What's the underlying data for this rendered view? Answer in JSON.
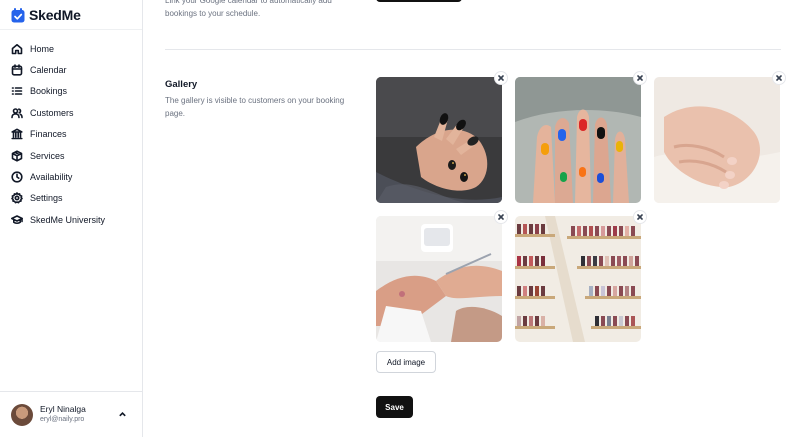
{
  "app": {
    "name": "SkedMe",
    "brand_color": "#2563eb"
  },
  "sidebar": {
    "items": [
      {
        "label": "Home",
        "icon": "home-icon"
      },
      {
        "label": "Calendar",
        "icon": "calendar-icon"
      },
      {
        "label": "Bookings",
        "icon": "list-icon"
      },
      {
        "label": "Customers",
        "icon": "users-icon"
      },
      {
        "label": "Finances",
        "icon": "bank-icon"
      },
      {
        "label": "Services",
        "icon": "box-icon"
      },
      {
        "label": "Availability",
        "icon": "clock-icon"
      },
      {
        "label": "Settings",
        "icon": "gear-icon"
      },
      {
        "label": "SkedMe University",
        "icon": "graduation-cap-icon"
      }
    ],
    "user": {
      "name": "Eryl Ninalga",
      "email": "eryl@naily.pro"
    }
  },
  "calendar_section": {
    "description": "Link your Google calendar to automatically add bookings to your schedule."
  },
  "gallery": {
    "title": "Gallery",
    "description": "The gallery is visible to customers on your booking page.",
    "images": [
      {
        "subject": "dark-manicure-photo"
      },
      {
        "subject": "colorful-nail-art-photo"
      },
      {
        "subject": "nude-manicure-photo"
      },
      {
        "subject": "manicure-session-photo"
      },
      {
        "subject": "nail-polish-shelves-photo"
      }
    ],
    "add_label": "Add image",
    "save_label": "Save"
  }
}
